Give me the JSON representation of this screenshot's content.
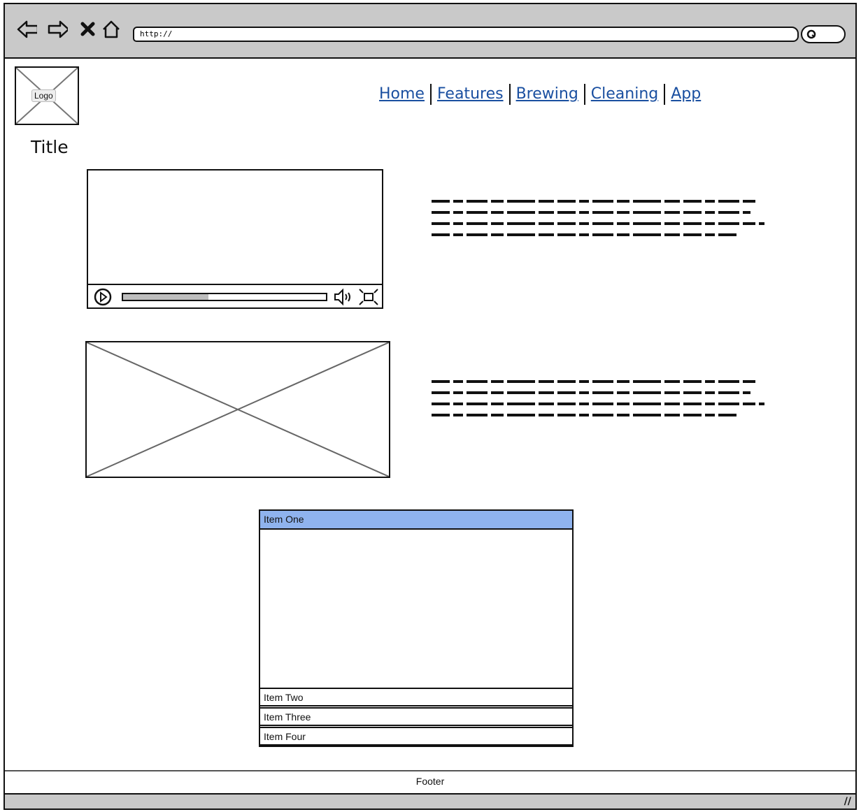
{
  "browser": {
    "url": "http://",
    "nav_icons": [
      "back-arrow-icon",
      "forward-arrow-icon",
      "close-icon",
      "home-icon"
    ]
  },
  "header": {
    "logo_label": "Logo",
    "nav_links": [
      {
        "label": "Home"
      },
      {
        "label": "Features"
      },
      {
        "label": "Brewing"
      },
      {
        "label": "Cleaning"
      },
      {
        "label": "App"
      }
    ]
  },
  "main": {
    "title": "Title",
    "video": {
      "progress": 0.42
    },
    "accordion": {
      "items": [
        {
          "label": "Item One",
          "expanded": true
        },
        {
          "label": "Item Two",
          "expanded": false
        },
        {
          "label": "Item Three",
          "expanded": false
        },
        {
          "label": "Item Four",
          "expanded": false
        }
      ]
    }
  },
  "footer": {
    "label": "Footer"
  },
  "colors": {
    "chrome": "#c9c9c9",
    "link": "#1a4fa0",
    "selected": "#8fb3ee"
  }
}
